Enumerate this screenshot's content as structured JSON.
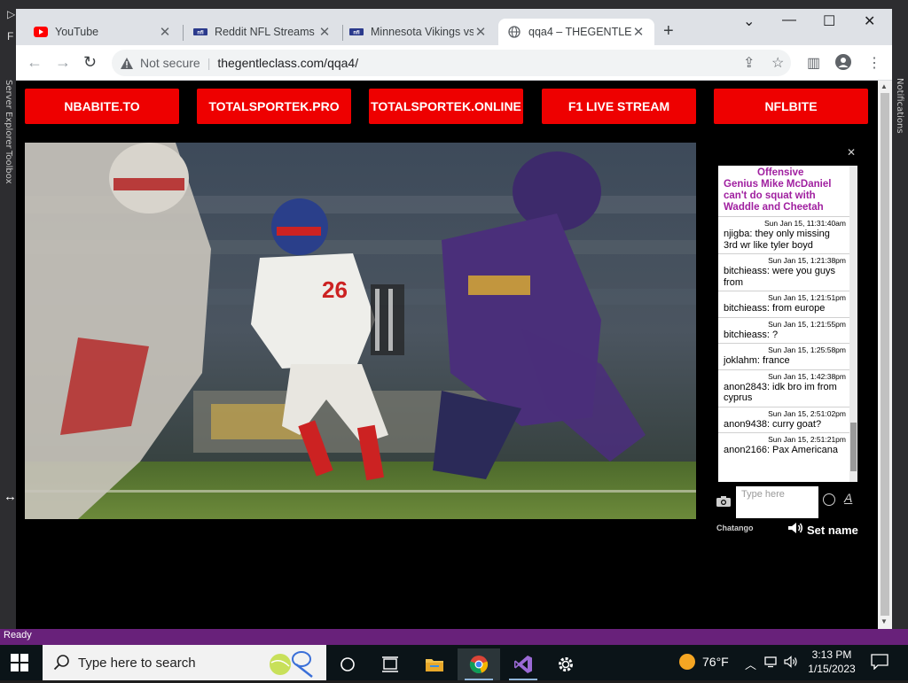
{
  "ide": {
    "left_label_1": "Server Explorer",
    "left_label_2": "Toolbox",
    "right_label": "Notifications",
    "status": "Ready"
  },
  "browser": {
    "tabs": [
      {
        "title": "YouTube",
        "icon": "youtube-icon"
      },
      {
        "title": "Reddit NFL Streams F",
        "icon": "nflbite-icon"
      },
      {
        "title": "Minnesota Vikings vs",
        "icon": "nflbite-icon"
      },
      {
        "title": "qqa4 – THEGENTLECL",
        "icon": "globe-icon",
        "active": true
      }
    ],
    "address": {
      "security": "Not secure",
      "url": "thegentleclass.com/qqa4/"
    }
  },
  "site": {
    "nav_buttons": [
      "NBABITE.TO",
      "TOTALSPORTEK.PRO",
      "TOTALSPORTEK.ONLINE",
      "F1 LIVE STREAM",
      "NFLBITE"
    ],
    "accent": "#ee0000"
  },
  "chat": {
    "top_message": [
      "Offensive",
      "Genius Mike McDaniel",
      "can't do squat with",
      "Waddle and Cheetah"
    ],
    "messages": [
      {
        "ts": "Sun Jan 15, 11:31:40am",
        "text": "njigba: they only missing 3rd wr like tyler boyd"
      },
      {
        "ts": "Sun Jan 15, 1:21:38pm",
        "text": "bitchieass: were you guys from"
      },
      {
        "ts": "Sun Jan 15, 1:21:51pm",
        "text": "bitchieass: from europe"
      },
      {
        "ts": "Sun Jan 15, 1:21:55pm",
        "text": "bitchieass: ?"
      },
      {
        "ts": "Sun Jan 15, 1:25:58pm",
        "text": "joklahm: france"
      },
      {
        "ts": "Sun Jan 15, 1:42:38pm",
        "text": "anon2843: idk bro im from cyprus"
      },
      {
        "ts": "Sun Jan 15, 2:51:02pm",
        "text": "anon9438: curry goat?"
      },
      {
        "ts": "Sun Jan 15, 2:51:21pm",
        "text": "anon2166: Pax Americana"
      }
    ],
    "input_placeholder": "Type here",
    "brand": "Chatango",
    "set_name": "Set name"
  },
  "taskbar": {
    "search_placeholder": "Type here to search",
    "weather": "76°F",
    "time": "3:13 PM",
    "date": "1/15/2023"
  }
}
